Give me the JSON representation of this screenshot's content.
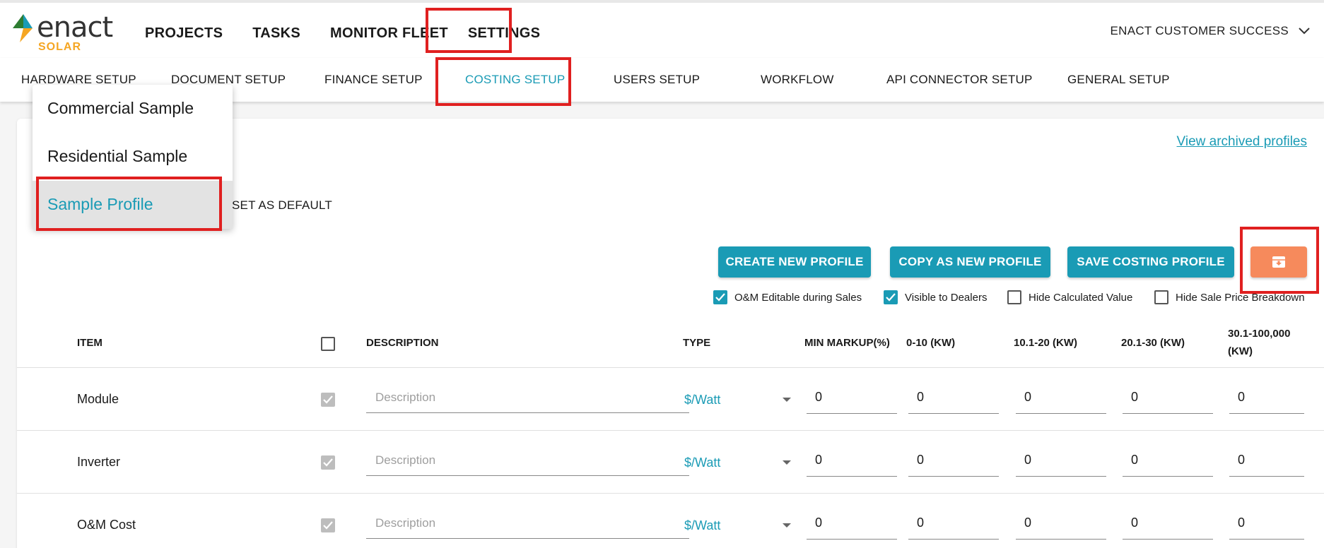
{
  "brand": {
    "name": "enact",
    "sub": "SOLAR"
  },
  "main_nav": [
    "PROJECTS",
    "TASKS",
    "MONITOR FLEET",
    "SETTINGS"
  ],
  "user": {
    "name": "ENACT CUSTOMER SUCCESS"
  },
  "sub_nav": [
    "HARDWARE SETUP",
    "DOCUMENT SETUP",
    "FINANCE SETUP",
    "COSTING SETUP",
    "USERS SETUP",
    "WORKFLOW",
    "API CONNECTOR SETUP",
    "GENERAL SETUP"
  ],
  "sub_nav_active": "COSTING SETUP",
  "archived_link": "View archived profiles",
  "profile_dropdown": {
    "options": [
      "Commercial Sample",
      "Residential Sample",
      "Sample Profile"
    ],
    "selected": "Sample Profile"
  },
  "set_default_label": "SET AS DEFAULT",
  "buttons": {
    "create": "CREATE NEW PROFILE",
    "copy": "COPY AS NEW PROFILE",
    "save": "SAVE COSTING PROFILE",
    "archive_icon": "archive-icon"
  },
  "options": [
    {
      "label": "O&M Editable during Sales",
      "checked": true
    },
    {
      "label": "Visible to Dealers",
      "checked": true
    },
    {
      "label": "Hide Calculated Value",
      "checked": false
    },
    {
      "label": "Hide Sale Price Breakdown",
      "checked": false
    }
  ],
  "table": {
    "headers": {
      "item": "ITEM",
      "description": "DESCRIPTION",
      "type": "TYPE",
      "min_markup": "MIN MARKUP(%)",
      "t1": "0-10 (KW)",
      "t2": "10.1-20 (KW)",
      "t3": "20.1-30 (KW)",
      "t4_line1": "30.1-100,000",
      "t4_line2": "(KW)"
    },
    "rows": [
      {
        "item": "Module",
        "description_placeholder": "Description",
        "type": "$/Watt",
        "min_markup": "0",
        "t1": "0",
        "t2": "0",
        "t3": "0",
        "t4": "0"
      },
      {
        "item": "Inverter",
        "description_placeholder": "Description",
        "type": "$/Watt",
        "min_markup": "0",
        "t1": "0",
        "t2": "0",
        "t3": "0",
        "t4": "0"
      },
      {
        "item": "O&M Cost",
        "description_placeholder": "Description",
        "type": "$/Watt",
        "min_markup": "0",
        "t1": "0",
        "t2": "0",
        "t3": "0",
        "t4": "0"
      }
    ]
  },
  "colors": {
    "accent": "#1a9bb5",
    "highlight": "#e02020",
    "archive": "#f68a5c",
    "brand_sub": "#f5a623"
  }
}
